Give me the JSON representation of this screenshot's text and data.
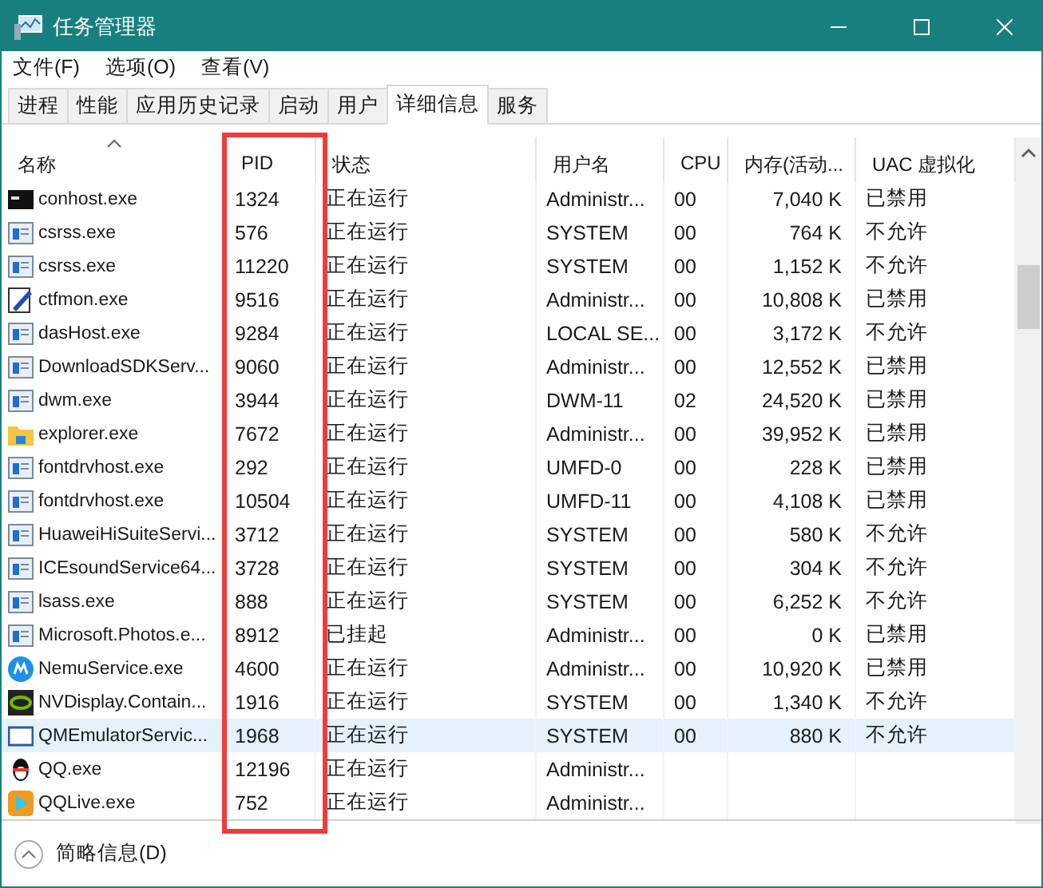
{
  "window": {
    "title": "任务管理器"
  },
  "menu": [
    "文件(F)",
    "选项(O)",
    "查看(V)"
  ],
  "tabs": [
    {
      "label": "进程",
      "selected": false
    },
    {
      "label": "性能",
      "selected": false
    },
    {
      "label": "应用历史记录",
      "selected": false
    },
    {
      "label": "启动",
      "selected": false
    },
    {
      "label": "用户",
      "selected": false
    },
    {
      "label": "详细信息",
      "selected": true
    },
    {
      "label": "服务",
      "selected": false
    }
  ],
  "table": {
    "columns": [
      "名称",
      "PID",
      "状态",
      "用户名",
      "CPU",
      "内存(活动...",
      "UAC 虚拟化"
    ],
    "rows": [
      {
        "kind": "console",
        "selected": false,
        "cells": [
          "conhost.exe",
          "1324",
          "正在运行",
          "Administr...",
          "00",
          "7,040 K",
          "已禁用"
        ]
      },
      {
        "kind": "window",
        "selected": false,
        "cells": [
          "csrss.exe",
          "576",
          "正在运行",
          "SYSTEM",
          "00",
          "764 K",
          "不允许"
        ]
      },
      {
        "kind": "window",
        "selected": false,
        "cells": [
          "csrss.exe",
          "11220",
          "正在运行",
          "SYSTEM",
          "00",
          "1,152 K",
          "不允许"
        ]
      },
      {
        "kind": "pen",
        "selected": false,
        "cells": [
          "ctfmon.exe",
          "9516",
          "正在运行",
          "Administr...",
          "00",
          "10,808 K",
          "已禁用"
        ]
      },
      {
        "kind": "window",
        "selected": false,
        "cells": [
          "dasHost.exe",
          "9284",
          "正在运行",
          "LOCAL SE...",
          "00",
          "3,172 K",
          "不允许"
        ]
      },
      {
        "kind": "window",
        "selected": false,
        "cells": [
          "DownloadSDKServ...",
          "9060",
          "正在运行",
          "Administr...",
          "00",
          "12,552 K",
          "已禁用"
        ]
      },
      {
        "kind": "window",
        "selected": false,
        "cells": [
          "dwm.exe",
          "3944",
          "正在运行",
          "DWM-11",
          "02",
          "24,520 K",
          "已禁用"
        ]
      },
      {
        "kind": "folder",
        "selected": false,
        "cells": [
          "explorer.exe",
          "7672",
          "正在运行",
          "Administr...",
          "00",
          "39,952 K",
          "已禁用"
        ]
      },
      {
        "kind": "window",
        "selected": false,
        "cells": [
          "fontdrvhost.exe",
          "292",
          "正在运行",
          "UMFD-0",
          "00",
          "228 K",
          "已禁用"
        ]
      },
      {
        "kind": "window",
        "selected": false,
        "cells": [
          "fontdrvhost.exe",
          "10504",
          "正在运行",
          "UMFD-11",
          "00",
          "4,108 K",
          "已禁用"
        ]
      },
      {
        "kind": "window",
        "selected": false,
        "cells": [
          "HuaweiHiSuiteServi...",
          "3712",
          "正在运行",
          "SYSTEM",
          "00",
          "580 K",
          "不允许"
        ]
      },
      {
        "kind": "window",
        "selected": false,
        "cells": [
          "ICEsoundService64...",
          "3728",
          "正在运行",
          "SYSTEM",
          "00",
          "304 K",
          "不允许"
        ]
      },
      {
        "kind": "window",
        "selected": false,
        "cells": [
          "lsass.exe",
          "888",
          "正在运行",
          "SYSTEM",
          "00",
          "6,252 K",
          "不允许"
        ]
      },
      {
        "kind": "window",
        "selected": false,
        "cells": [
          "Microsoft.Photos.e...",
          "8912",
          "已挂起",
          "Administr...",
          "00",
          "0 K",
          "已禁用"
        ]
      },
      {
        "kind": "circle",
        "selected": false,
        "cells": [
          "NemuService.exe",
          "4600",
          "正在运行",
          "Administr...",
          "00",
          "10,920 K",
          "已禁用"
        ]
      },
      {
        "kind": "chip",
        "selected": false,
        "cells": [
          "NVDisplay.Contain...",
          "1916",
          "正在运行",
          "SYSTEM",
          "00",
          "1,340 K",
          "不允许"
        ]
      },
      {
        "kind": "frame",
        "selected": true,
        "cells": [
          "QMEmulatorServic...",
          "1968",
          "正在运行",
          "SYSTEM",
          "00",
          "880 K",
          "不允许"
        ]
      },
      {
        "kind": "penguin",
        "selected": false,
        "cells": [
          "QQ.exe",
          "12196",
          "正在运行",
          "Administr..."
        ]
      },
      {
        "kind": "play",
        "selected": false,
        "cells": [
          "QQLive.exe",
          "752",
          "正在运行",
          "Administr..."
        ]
      }
    ]
  },
  "footer": {
    "label": "简略信息(D)"
  }
}
